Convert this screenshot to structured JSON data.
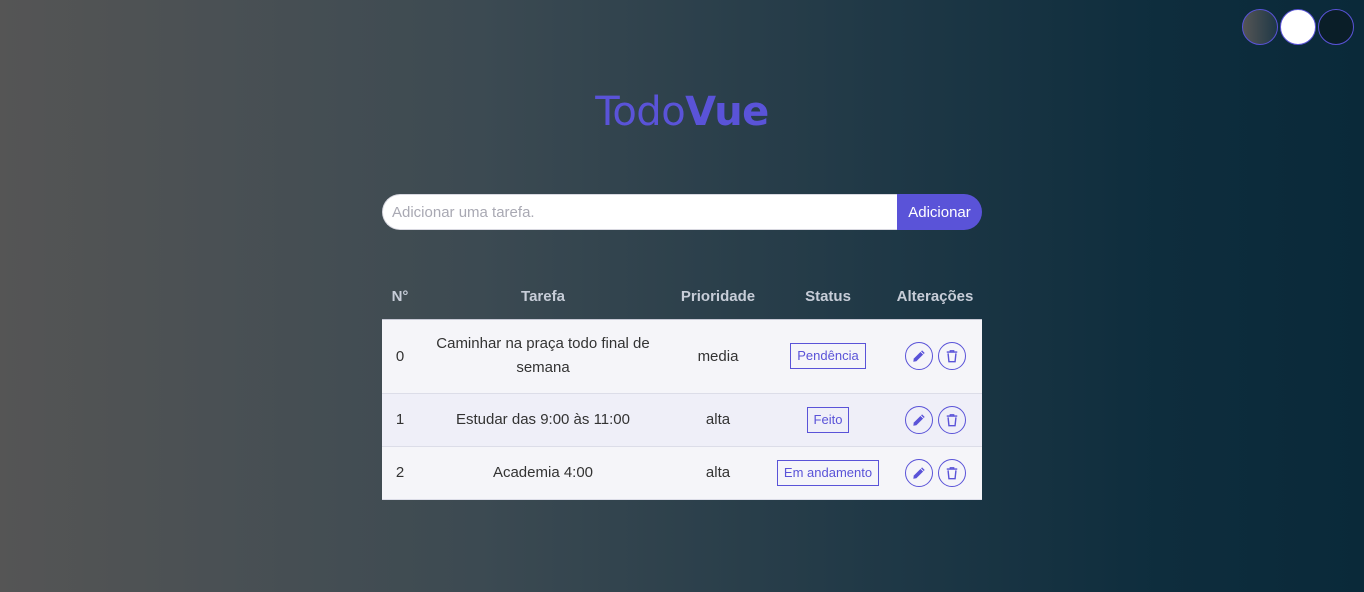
{
  "theme_switcher": {
    "options": [
      "gradient",
      "light",
      "dark"
    ]
  },
  "title": {
    "part1": "Todo",
    "part2": "Vue"
  },
  "add_form": {
    "placeholder": "Adicionar uma tarefa.",
    "value": "",
    "button_label": "Adicionar"
  },
  "table": {
    "headers": {
      "number": "N°",
      "task": "Tarefa",
      "priority": "Prioridade",
      "status": "Status",
      "actions": "Alterações"
    },
    "rows": [
      {
        "number": "0",
        "task": "Caminhar na praça todo final de semana",
        "priority": "media",
        "status": "Pendência"
      },
      {
        "number": "1",
        "task": "Estudar das 9:00 às 11:00",
        "priority": "alta",
        "status": "Feito"
      },
      {
        "number": "2",
        "task": "Academia 4:00",
        "priority": "alta",
        "status": "Em andamento"
      }
    ]
  },
  "colors": {
    "accent": "#5a53d8",
    "header_text": "#c7cdd8",
    "row_background": "#f5f5f9",
    "row_background_alt": "#efeff8"
  },
  "icons": {
    "edit": "pencil-icon",
    "delete": "trash-icon"
  }
}
